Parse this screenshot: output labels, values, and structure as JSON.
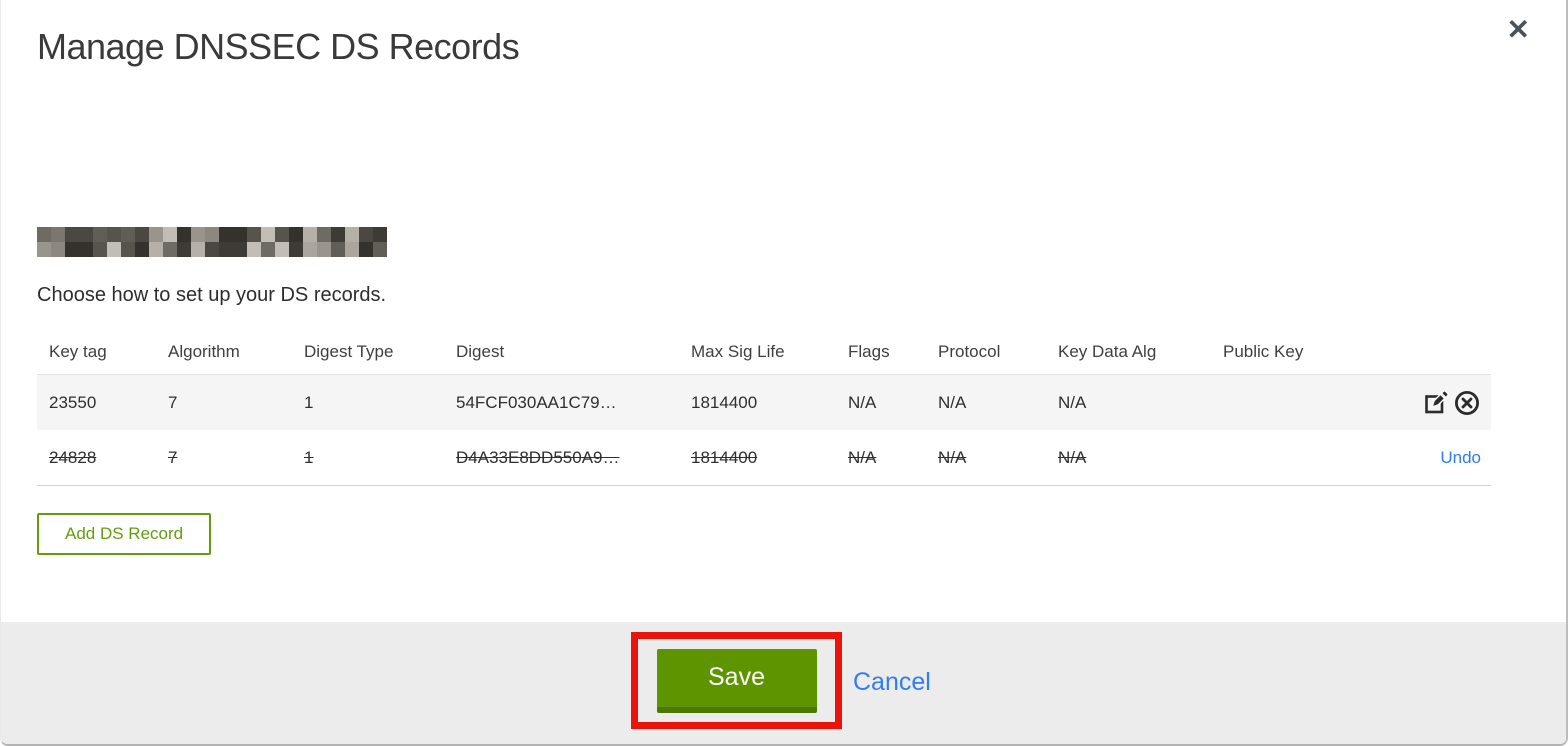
{
  "header": {
    "title": "Manage DNSSEC DS Records"
  },
  "icons": {
    "close_glyph": "✕"
  },
  "intro": {
    "domain_redacted": true,
    "instruction": "Choose how to set up your DS records."
  },
  "table": {
    "columns": [
      "Key tag",
      "Algorithm",
      "Digest Type",
      "Digest",
      "Max Sig Life",
      "Flags",
      "Protocol",
      "Key Data Alg",
      "Public Key"
    ],
    "rows": [
      {
        "key_tag": "23550",
        "algorithm": "7",
        "digest_type": "1",
        "digest": "54FCF030AA1C79…",
        "max_sig_life": "1814400",
        "flags": "N/A",
        "protocol": "N/A",
        "key_data_alg": "N/A",
        "public_key": "",
        "state": "current",
        "actions": [
          "edit",
          "delete"
        ]
      },
      {
        "key_tag": "24828",
        "algorithm": "7",
        "digest_type": "1",
        "digest": "D4A33E8DD550A9…",
        "max_sig_life": "1814400",
        "flags": "N/A",
        "protocol": "N/A",
        "key_data_alg": "N/A",
        "public_key": "",
        "state": "deleted",
        "action_label": "Undo"
      }
    ]
  },
  "buttons": {
    "add_ds_record": "Add DS Record",
    "save": "Save",
    "cancel": "Cancel"
  },
  "annotation": {
    "type": "highlight-box",
    "target": "save-button",
    "color": "#e9150d"
  },
  "colors": {
    "button_green": "#5d9400",
    "button_green_dark": "#4a7800",
    "outline_green": "#659c0e",
    "link_blue": "#2f7df0",
    "row_alt_bg": "#f5f5f5",
    "footer_bg": "#ececec"
  }
}
